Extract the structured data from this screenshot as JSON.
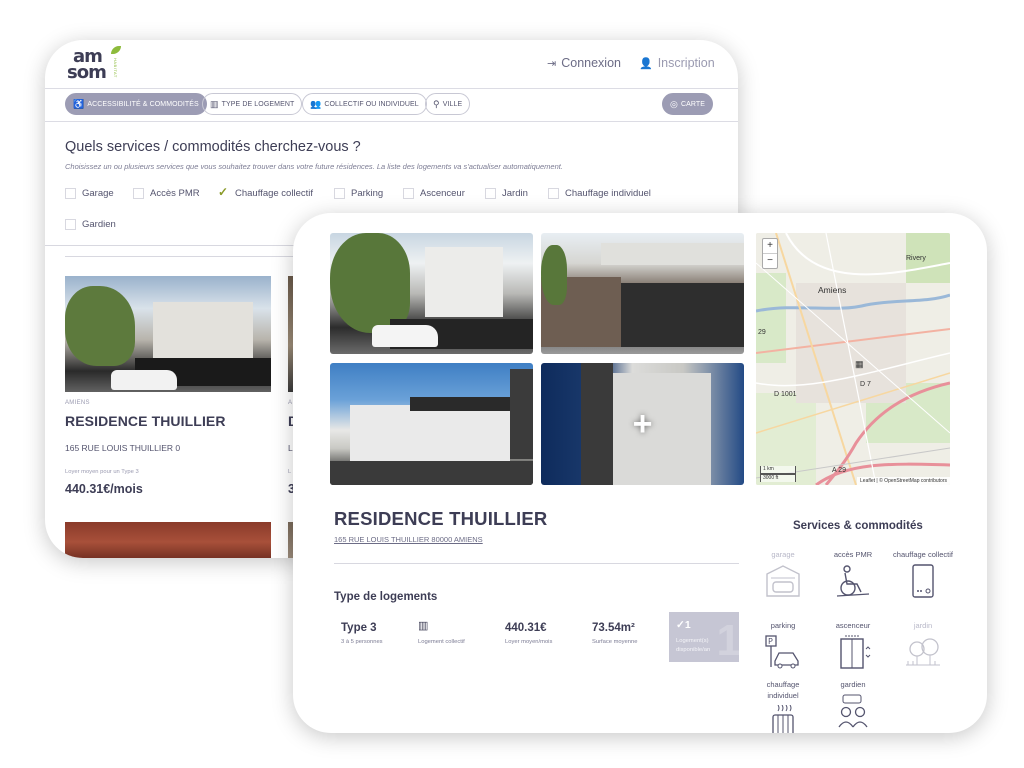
{
  "colors": {
    "accent": "#9c9cb4",
    "text": "#3d3d55",
    "leaf": "#8dbb3c",
    "check": "#8a9a28",
    "available_box": "#c6c6d4"
  },
  "logo": {
    "line1": "am",
    "line2": "som",
    "vertical": "HABITAT"
  },
  "header": {
    "login_label": "Connexion",
    "signup_label": "Inscription"
  },
  "filters": [
    {
      "label": "Accessibilité & commodités",
      "icon": "accessibility-icon",
      "active": true
    },
    {
      "label": "Type de logement",
      "icon": "building-icon",
      "active": false
    },
    {
      "label": "Collectif ou individuel",
      "icon": "people-icon",
      "active": false
    },
    {
      "label": "Ville",
      "icon": "map-pin-icon",
      "active": false
    }
  ],
  "map_button_label": "Carte",
  "search": {
    "title": "Quels services / commodités cherchez-vous ?",
    "subtitle": "Choisissez un ou plusieurs services que vous souhaitez trouver dans votre future résidences. La liste des logements va s'actualiser automatiquement.",
    "options": [
      {
        "label": "Garage",
        "checked": false
      },
      {
        "label": "Accès PMR",
        "checked": false
      },
      {
        "label": "Chauffage collectif",
        "checked": true
      },
      {
        "label": "Parking",
        "checked": false
      },
      {
        "label": "Ascenceur",
        "checked": false
      },
      {
        "label": "Jardin",
        "checked": false
      },
      {
        "label": "Chauffage individuel",
        "checked": false
      },
      {
        "label": "Gardien",
        "checked": false
      }
    ]
  },
  "listings": [
    {
      "city": "AMIENS",
      "name": "RESIDENCE THUILLIER",
      "address": "165 RUE LOUIS THUILLIER 0",
      "rent_label": "Loyer moyen pour un Type 3",
      "rent": "440.31€/mois"
    },
    {
      "city": "A",
      "name": "D",
      "address": "L",
      "rent_label": "L",
      "rent": "3"
    }
  ],
  "detail": {
    "title": "RESIDENCE THUILLIER",
    "address": "165 RUE LOUIS THUILLIER 80000 AMIENS",
    "type_heading": "Type de logements",
    "type": {
      "name": "Type 3",
      "persons": "3 à 5 personnes",
      "kind": "Logement collectif",
      "rent": "440.31€",
      "rent_label": "Loyer moyen/mois",
      "surface": "73.54m²",
      "surface_label": "Surface moyenne",
      "available_count": "1",
      "available_label_1": "Logement(s)",
      "available_label_2": "disponible/an",
      "ghost_digit": "1"
    },
    "photos_more": "+",
    "map": {
      "zoom_in": "+",
      "zoom_out": "−",
      "label_city": "Amiens",
      "label_rivery": "Rivery",
      "label_d7": "D 7",
      "label_d1001": "D 1001",
      "label_a29": "A 29",
      "label_29": "29",
      "scale_km": "1 km",
      "scale_ft": "3000 ft",
      "attribution": "Leaflet | © OpenStreetMap contributors"
    },
    "services_heading": "Services & commodités",
    "services": [
      {
        "label": "garage",
        "available": false,
        "icon": "garage-icon"
      },
      {
        "label": "accès PMR",
        "available": true,
        "icon": "wheelchair-icon"
      },
      {
        "label": "chauffage collectif",
        "available": true,
        "icon": "boiler-icon"
      },
      {
        "label": "parking",
        "available": true,
        "icon": "parking-icon"
      },
      {
        "label": "ascenceur",
        "available": true,
        "icon": "elevator-icon"
      },
      {
        "label": "jardin",
        "available": false,
        "icon": "garden-icon"
      },
      {
        "label": "chauffage individuel",
        "available": true,
        "icon": "radiator-icon"
      },
      {
        "label": "gardien",
        "available": true,
        "icon": "concierge-icon"
      }
    ]
  }
}
